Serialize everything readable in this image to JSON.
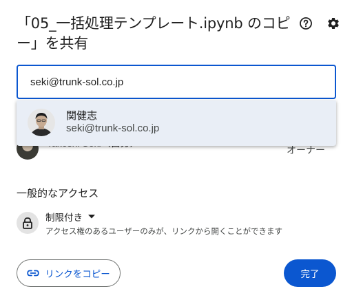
{
  "dialog": {
    "title": "「05_一括処理テンプレート.ipynb のコピー」を共有"
  },
  "header": {
    "help_icon": "help-circle-icon",
    "settings_icon": "gear-icon"
  },
  "share_input": {
    "value": "seki@trunk-sol.co.jp"
  },
  "suggestion": {
    "name": "関健志",
    "email": "seki@trunk-sol.co.jp"
  },
  "people": [
    {
      "name": "Takeshi Seki（自分）",
      "role": "オーナー"
    }
  ],
  "general_access": {
    "title": "一般的なアクセス",
    "selected": "制限付き",
    "description": "アクセス権のあるユーザーのみが、リンクから開くことができます",
    "icon": "lock-icon"
  },
  "footer": {
    "copy_link_label": "リンクをコピー",
    "done_label": "完了"
  },
  "colors": {
    "accent": "#0b57d0",
    "suggestion_bg": "#e9eef6"
  }
}
